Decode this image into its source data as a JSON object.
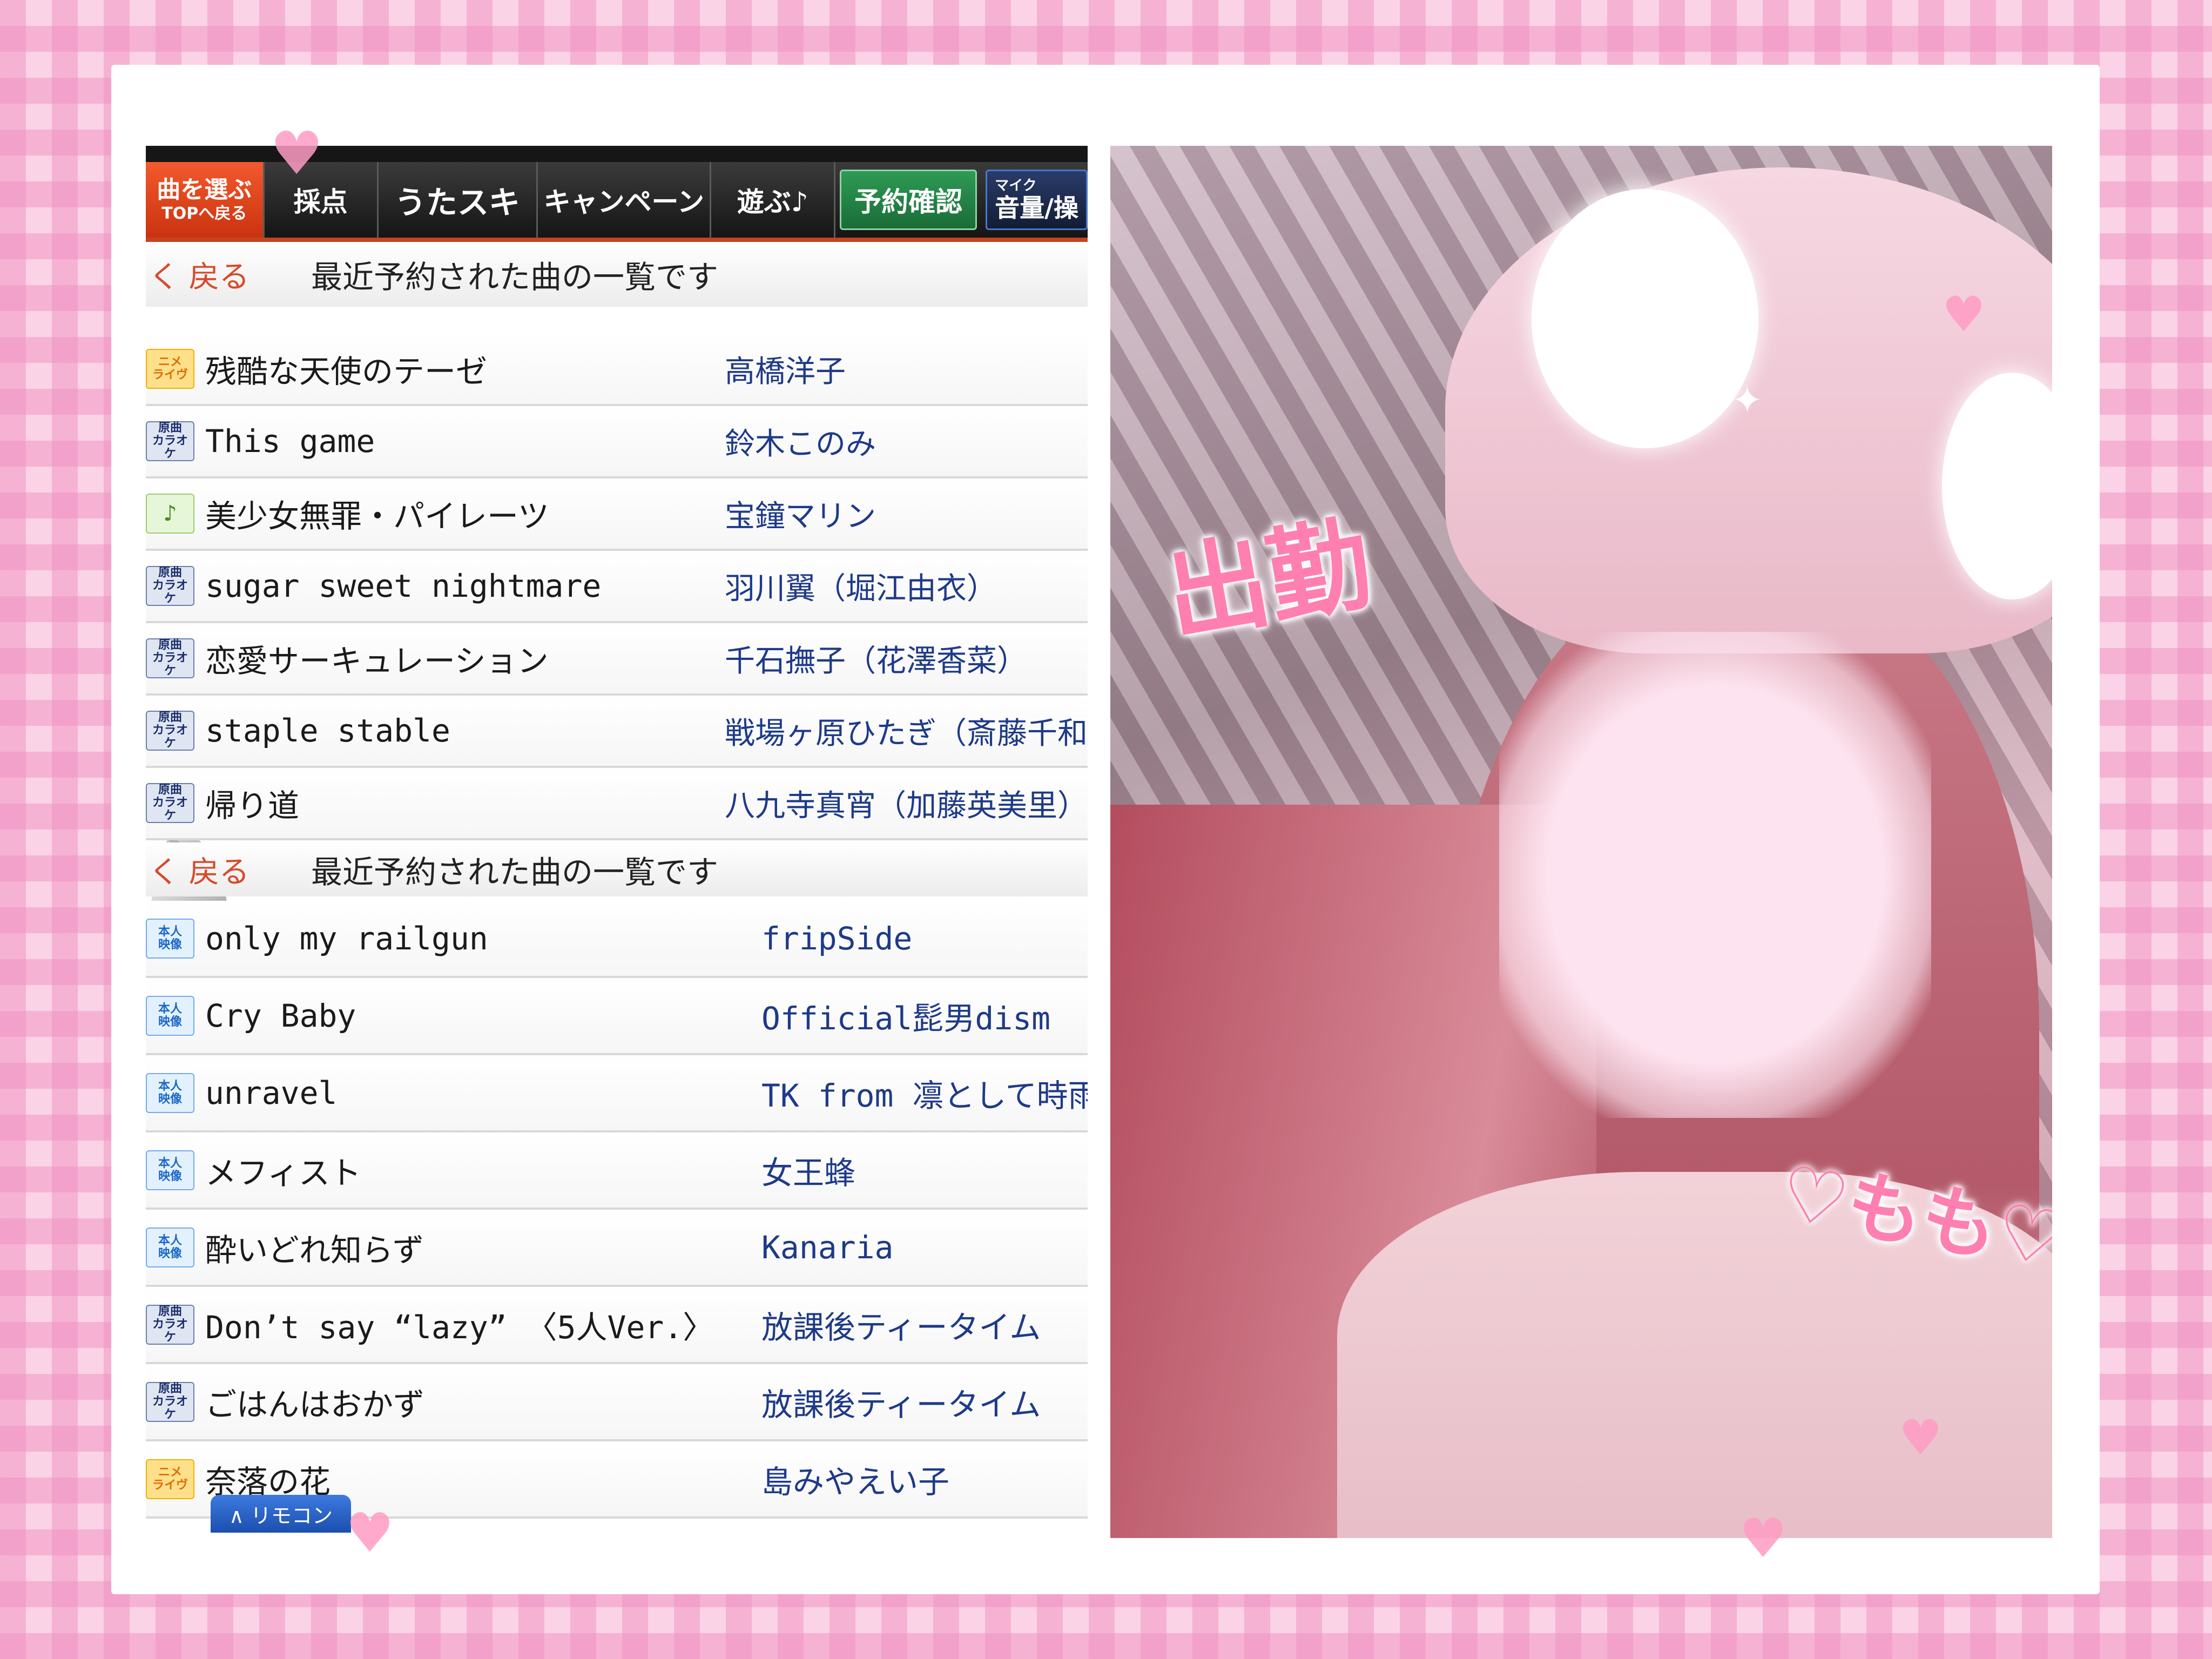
{
  "navbar": {
    "top_line1": "曲を選ぶ",
    "top_line2": "TOPへ戻る",
    "scoring": "採点",
    "utasuki": "うたスキ",
    "campaign": "キャンペーン",
    "play": "遊ぶ♪",
    "reservation_check": "予約確認",
    "volume_line1": "マイク",
    "volume_line2": "音量/操"
  },
  "section_a": {
    "back": "く 戻る",
    "title": "最近予約された曲の一覧です",
    "rows": [
      {
        "tag": "ニメ\nライヴ",
        "title": "残酷な天使のテーゼ",
        "artist": "高橋洋子"
      },
      {
        "tag": "原曲\nカラオケ",
        "title": "This game",
        "artist": "鈴木このみ"
      },
      {
        "tag": "♪",
        "title": "美少女無罪・パイレーツ",
        "artist": "宝鐘マリン"
      },
      {
        "tag": "原曲\nカラオケ",
        "title": "sugar sweet nightmare",
        "artist": "羽川翼（堀江由衣）"
      },
      {
        "tag": "原曲\nカラオケ",
        "title": "恋愛サーキュレーション",
        "artist": "千石撫子（花澤香菜）"
      },
      {
        "tag": "原曲\nカラオケ",
        "title": "staple stable",
        "artist": "戦場ヶ原ひたぎ（斎藤千和"
      },
      {
        "tag": "原曲\nカラオケ",
        "title": "帰り道",
        "artist": "八九寺真宵（加藤英美里）"
      }
    ]
  },
  "section_b": {
    "back": "く 戻る",
    "title": "最近予約された曲の一覧です",
    "rows": [
      {
        "tag": "本人\n映像",
        "title": "only my railgun",
        "artist": "fripSide"
      },
      {
        "tag": "本人\n映像",
        "title": "Cry Baby",
        "artist": "Official髭男dism"
      },
      {
        "tag": "本人\n映像",
        "title": "unravel",
        "artist": "TK from 凛として時雨"
      },
      {
        "tag": "本人\n映像",
        "title": "メフィスト",
        "artist": "女王蜂"
      },
      {
        "tag": "本人\n映像",
        "title": "酔いどれ知らず",
        "artist": "Kanaria"
      },
      {
        "tag": "原曲\nカラオケ",
        "title": "Don’t say “lazy” 〈5人Ver.〉",
        "artist": "放課後ティータイム"
      },
      {
        "tag": "原曲\nカラオケ",
        "title": "ごはんはおかず",
        "artist": "放課後ティータイム"
      },
      {
        "tag": "ニメ\nライヴ",
        "title": "奈落の花",
        "artist": "島みやえい子"
      }
    ]
  },
  "remote_button": "∧ リモコン",
  "photo": {
    "sticker_shukkin": "出勤",
    "sticker_momo": "♡もも♡"
  }
}
